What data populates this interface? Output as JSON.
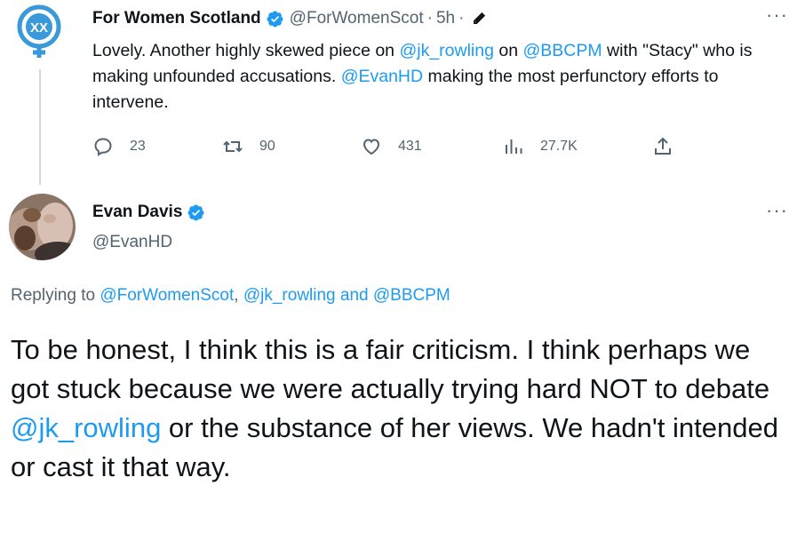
{
  "tweet1": {
    "display_name": "For Women Scotland",
    "handle": "@ForWomenScot",
    "separator": "·",
    "time": "5h",
    "separator2": "·",
    "text": {
      "p1": "Lovely. Another highly skewed piece on ",
      "mention1": "@jk_rowling",
      "p2": " on ",
      "mention2": "@BBCPM",
      "p3": " with \"Stacy\" who is making unfounded accusations. ",
      "mention3": "@EvanHD",
      "p4": " making the most perfunctory efforts to intervene."
    },
    "counts": {
      "replies": "23",
      "retweets": "90",
      "likes": "431",
      "views": "27.7K"
    },
    "more_label": "···"
  },
  "tweet2": {
    "display_name": "Evan Davis",
    "handle": "@EvanHD",
    "more_label": "···",
    "replying": {
      "prefix": "Replying to ",
      "mention1": "@ForWomenScot",
      "comma": ", ",
      "mention2": "@jk_rowling",
      "and": " and ",
      "mention3": "@BBCPM"
    },
    "text": {
      "p1": "To be honest, I think this is a fair criticism. I think perhaps we got stuck because we were actually trying hard NOT to debate ",
      "mention": "@jk_rowling",
      "p2": " or the substance of her views. We hadn't intended or cast it that way."
    }
  },
  "icons": {
    "avatar1": "women-symbol-xx-logo",
    "verified": "verified-badge-icon",
    "edit": "pen-icon",
    "reply": "reply-icon",
    "retweet": "retweet-icon",
    "like": "heart-icon",
    "views": "views-icon",
    "share": "share-icon",
    "more": "more-dots-icon"
  },
  "colors": {
    "link": "#1d9bf0",
    "secondary_text": "#536471",
    "primary_text": "#0f1419",
    "verified": "#1d9bf0",
    "thread_line": "#cfd9de"
  }
}
